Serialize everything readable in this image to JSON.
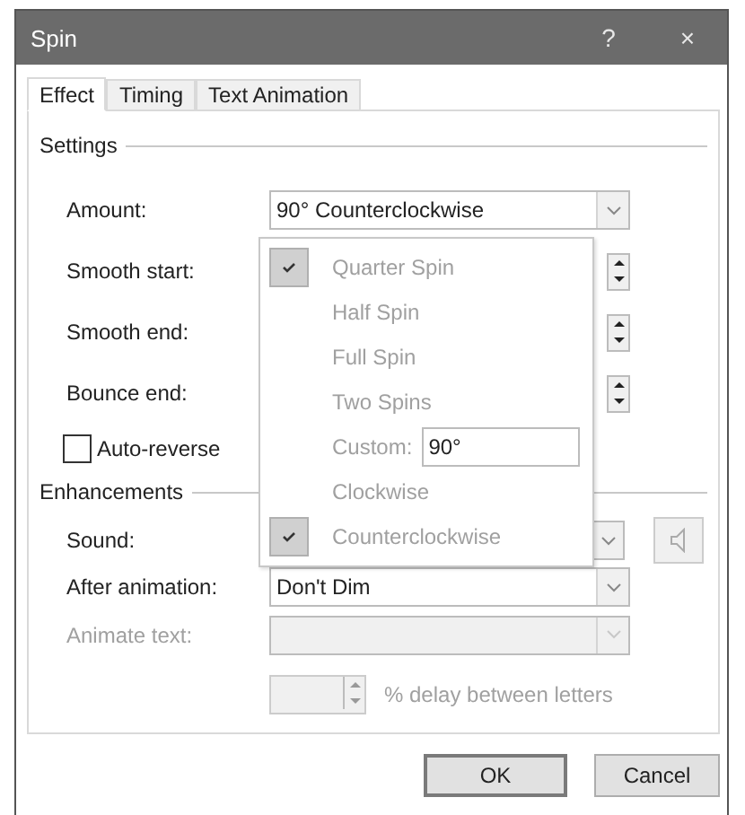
{
  "window": {
    "title": "Spin",
    "help": "?",
    "close": "×"
  },
  "tabs": [
    {
      "label": "Effect",
      "selected": true
    },
    {
      "label": "Timing",
      "selected": false
    },
    {
      "label": "Text Animation",
      "selected": false
    }
  ],
  "settings": {
    "title": "Settings",
    "amount": {
      "label": "Amount:",
      "value": "90° Counterclockwise"
    },
    "spin_rows": [
      {
        "label": "Smooth start:"
      },
      {
        "label": "Smooth end:"
      },
      {
        "label": "Bounce end:"
      }
    ],
    "auto_reverse": {
      "label": "Auto-reverse",
      "checked": false
    }
  },
  "dropdown": {
    "items": [
      {
        "kind": "option",
        "label": "Quarter Spin",
        "checked": true
      },
      {
        "kind": "option",
        "label": "Half Spin",
        "checked": false
      },
      {
        "kind": "option",
        "label": "Full Spin",
        "checked": false
      },
      {
        "kind": "option",
        "label": "Two Spins",
        "checked": false
      },
      {
        "kind": "custom",
        "label": "Custom:",
        "value": "90°"
      },
      {
        "kind": "option",
        "label": "Clockwise",
        "checked": false
      },
      {
        "kind": "option",
        "label": "Counterclockwise",
        "checked": true
      }
    ]
  },
  "enhancements": {
    "title": "Enhancements",
    "sound": {
      "label": "Sound:"
    },
    "after_animation": {
      "label": "After animation:",
      "value": "Don't Dim"
    },
    "animate_text": {
      "label": "Animate text:",
      "disabled": true
    },
    "delay": {
      "label": "% delay between letters",
      "disabled": true
    }
  },
  "buttons": [
    {
      "label": "OK",
      "default": true
    },
    {
      "label": "Cancel",
      "default": false
    }
  ]
}
